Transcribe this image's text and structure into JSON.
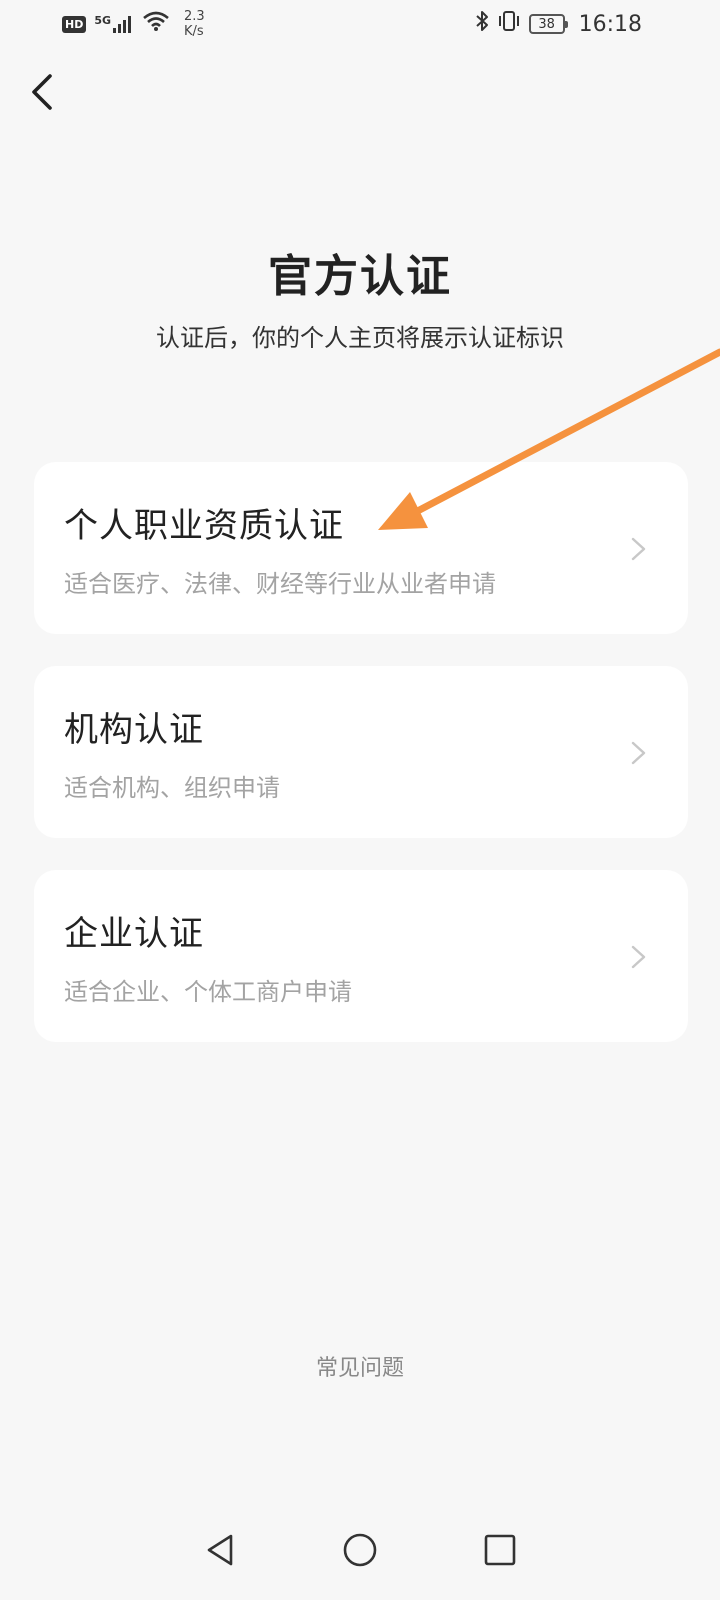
{
  "status_bar": {
    "hd_badge": "HD",
    "network": "5G",
    "speed_value": "2.3",
    "speed_unit": "K/s",
    "battery": "38",
    "time": "16:18"
  },
  "header": {
    "title": "官方认证",
    "subtitle": "认证后，你的个人主页将展示认证标识"
  },
  "cards": [
    {
      "title": "个人职业资质认证",
      "desc": "适合医疗、法律、财经等行业从业者申请"
    },
    {
      "title": "机构认证",
      "desc": "适合机构、组织申请"
    },
    {
      "title": "企业认证",
      "desc": "适合企业、个体工商户申请"
    }
  ],
  "footer": {
    "faq": "常见问题"
  },
  "colors": {
    "background": "#f7f7f7",
    "card": "#ffffff",
    "annotation_arrow": "#f5923e"
  },
  "icons": {
    "back": "back-arrow-icon",
    "chevron": "chevron-right-icon",
    "nav_back": "nav-back-icon",
    "nav_home": "nav-home-icon",
    "nav_recents": "nav-recents-icon"
  }
}
